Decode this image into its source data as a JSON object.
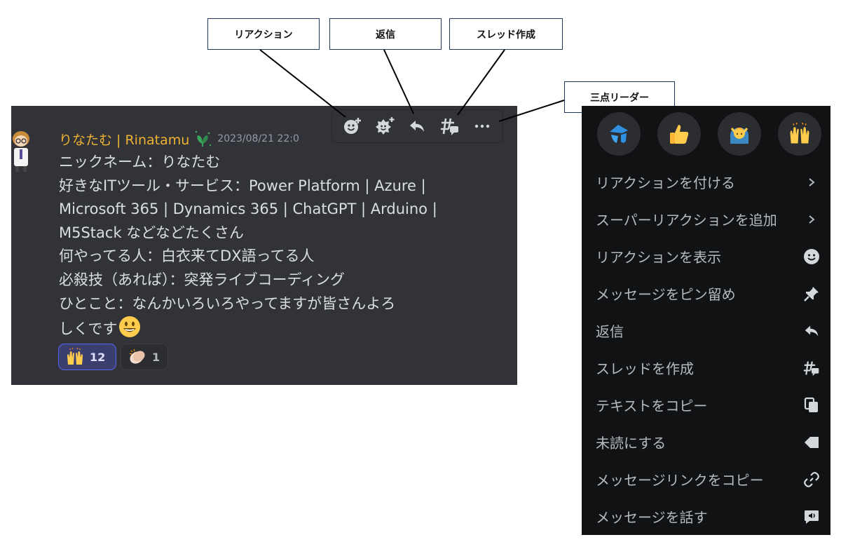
{
  "callouts": {
    "reaction": "リアクション",
    "reply": "返信",
    "create_thread": "スレッド作成",
    "more": "三点リーダー"
  },
  "message": {
    "username": "りなたむ | Rinatamu",
    "timestamp": "2023/08/21 22:0",
    "lines": [
      "ニックネーム：りなたむ",
      "好きなITツール・サービス：Power Platform | Azure |",
      "Microsoft 365 | Dynamics 365 | ChatGPT | Arduino |",
      "M5Stack などなどたくさん",
      "何やってる人：白衣来てDX語ってる人",
      "必殺技（あれば）：突発ライブコーディング",
      "ひとこと：なんかいろいろやってますが皆さんよろ",
      "しくです"
    ],
    "reactions": [
      {
        "emoji": "raised-hands",
        "count": "12",
        "active": true
      },
      {
        "emoji": "clapping-hands",
        "count": "1",
        "active": false
      }
    ]
  },
  "toolbar": {
    "buttons": [
      "add-reaction",
      "add-super-reaction",
      "reply",
      "create-thread",
      "more"
    ]
  },
  "context_menu": {
    "quick_reactions": [
      "custom-blue-emoji",
      "thumbs-up",
      "person-gesturing",
      "raised-hands"
    ],
    "items": [
      {
        "label": "リアクションを付ける",
        "icon": "chevron-right-icon"
      },
      {
        "label": "スーパーリアクションを追加",
        "icon": "chevron-right-icon"
      },
      {
        "label": "リアクションを表示",
        "icon": "smiley-icon"
      },
      {
        "label": "メッセージをピン留め",
        "icon": "pin-icon"
      },
      {
        "label": "返信",
        "icon": "reply-icon"
      },
      {
        "label": "スレッドを作成",
        "icon": "thread-icon"
      },
      {
        "label": "テキストをコピー",
        "icon": "copy-icon"
      },
      {
        "label": "未読にする",
        "icon": "mark-unread-icon"
      },
      {
        "label": "メッセージリンクをコピー",
        "icon": "link-icon"
      },
      {
        "label": "メッセージを話す",
        "icon": "speak-icon"
      }
    ]
  },
  "colors": {
    "username": "#f0b232",
    "panel_bg": "#313338",
    "menu_bg": "#111214",
    "active_reaction_border": "#5865f2"
  }
}
